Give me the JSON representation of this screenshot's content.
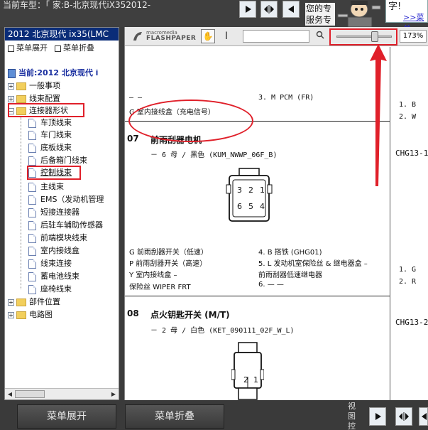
{
  "header": {
    "car_label": "当前车型：「 家:B-北京现代iX352012-",
    "service_text": "您的专服务专",
    "side_text": "字!",
    "side_link": ">>菜单"
  },
  "tree": {
    "title": "2012 北京现代 ix35(LMC",
    "expand_label": "菜单展开",
    "collapse_label": "菜单折叠",
    "root_label": "当前:2012 北京现代 i",
    "folders": [
      {
        "label": "一般事项",
        "state": "collapsed"
      },
      {
        "label": "线束配置",
        "state": "collapsed"
      },
      {
        "label": "连接器形状",
        "state": "expanded"
      }
    ],
    "children": [
      "车顶线束",
      "车门线束",
      "底板线束",
      "后备箱门线束",
      "控制线束",
      "主线束",
      "EMS（发动机管理",
      "短接连接器",
      "后驻车辅助传感器",
      "前端模块线束",
      "室内接线盒",
      "线束连接",
      "蓄电池线束",
      "座椅线束"
    ],
    "bottom_folders": [
      "部件位置",
      "电路图"
    ],
    "selected_child": "控制线束"
  },
  "viewer": {
    "logo_top": "macromedia",
    "logo_bottom": "FLASHPAPER",
    "search_placeholder": "",
    "zoom_value": "173%",
    "zoom_level": 0.72
  },
  "document": {
    "top_rows": [
      {
        "left": "—    —",
        "right": "3. M      PCM (FR)"
      },
      {
        "left": "G    室内接线盒（充电信号）",
        "right": ""
      }
    ],
    "right_col_top": [
      "1. B",
      "2. W"
    ],
    "section7": {
      "num": "07",
      "title": "前雨刮器电机",
      "subtitle": "－ 6 母 / 黑色 (KUM_NWWP_06F_B)",
      "pins": [
        "3",
        "2",
        "1",
        "6",
        "5",
        "4"
      ],
      "rows": [
        {
          "left": "G    前雨刮器开关（低速）",
          "right": "4. B    搭铁 (GHG01)"
        },
        {
          "left": "P    前雨刮器开关（高速）",
          "right": "5. L    发动机室保险丝 & 继电器盒 –"
        },
        {
          "left": "Y    室内接线盒 –",
          "right": "        前雨刮器低速继电器"
        },
        {
          "left": "     保险丝 WIPER FRT",
          "right": "6. —    —"
        }
      ],
      "side_code": "CHG13-1",
      "side_rows": [
        "1. G",
        "2. R"
      ]
    },
    "section8": {
      "num": "08",
      "title": "点火钥匙开关 (M/T)",
      "subtitle": "－ 2 母 / 白色 (KET_090111_02F_W_L)",
      "pins": [
        "2",
        "1"
      ],
      "side_code": "CHG13-2"
    }
  },
  "footer": {
    "expand_label": "菜单展开",
    "collapse_label": "菜单折叠",
    "view_ctrl_label": "视图控"
  },
  "colors": {
    "annotation": "#e0202a",
    "tree_title_bg": "#0a2c78",
    "root_label": "#1a2fa0"
  }
}
